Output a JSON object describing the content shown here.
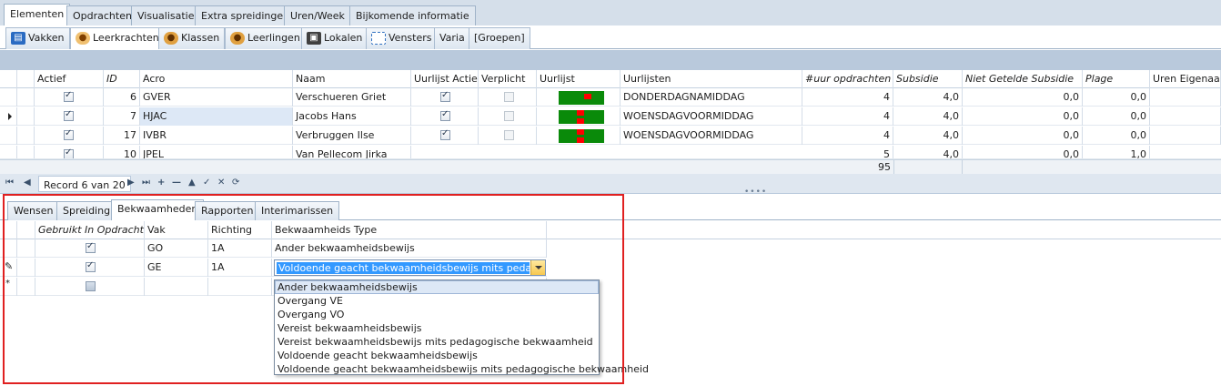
{
  "tabs_level1": [
    "Elementen",
    "Opdrachten",
    "Visualisatie",
    "Extra spreidingen",
    "Uren/Week",
    "Bijkomende informatie"
  ],
  "tabs_level2": [
    {
      "label": "Vakken",
      "icon": "book-icon"
    },
    {
      "label": "Leerkrachten",
      "icon": "person-icon"
    },
    {
      "label": "Klassen",
      "icon": "group-icon"
    },
    {
      "label": "Leerlingen",
      "icon": "students-icon"
    },
    {
      "label": "Lokalen",
      "icon": "room-icon"
    },
    {
      "label": "Vensters",
      "icon": "window-icon"
    },
    {
      "label": "Varia",
      "icon": ""
    },
    {
      "label": "[Groepen]",
      "icon": ""
    }
  ],
  "main_grid": {
    "columns": [
      "Actief",
      "ID",
      "Acro",
      "Naam",
      "Uurlijst Actief",
      "Verplicht",
      "Uurlijst",
      "Uurlijsten",
      "#uur opdrachten",
      "Subsidie",
      "Niet Getelde Subsidie",
      "Plage",
      "Uren Eigenaar"
    ],
    "rows": [
      {
        "id": "6",
        "acro": "GVER",
        "naam": "Verschueren Griet",
        "uurlijsten": "DONDERDAGNAMIDDAG",
        "uur": "4",
        "subsidie": "4,0",
        "niet": "0,0",
        "plage": "0,0"
      },
      {
        "id": "7",
        "acro": "HJAC",
        "naam": "Jacobs Hans",
        "uurlijsten": "WOENSDAGVOORMIDDAG",
        "uur": "4",
        "subsidie": "4,0",
        "niet": "0,0",
        "plage": "0,0"
      },
      {
        "id": "17",
        "acro": "IVBR",
        "naam": "Verbruggen Ilse",
        "uurlijsten": "WOENSDAGVOORMIDDAG",
        "uur": "4",
        "subsidie": "4,0",
        "niet": "0,0",
        "plage": "0,0"
      },
      {
        "id": "10",
        "acro": "JPEL",
        "naam": "Van Pellecom Jirka",
        "uurlijsten": "",
        "uur": "5",
        "subsidie": "4,0",
        "niet": "0,0",
        "plage": "1,0"
      }
    ],
    "sum": "95"
  },
  "navigator": {
    "record_text": "Record 6 van 20"
  },
  "tabs_level3": [
    "Wensen",
    "Spreiding",
    "Bekwaamheden",
    "Rapporten",
    "Interimarissen"
  ],
  "sub_grid": {
    "columns": [
      "Gebruikt In Opdracht",
      "Vak",
      "Richting",
      "Bekwaamheids Type"
    ],
    "rows": [
      {
        "vak": "GO",
        "richting": "1A",
        "type": "Ander bekwaamheidsbewijs"
      },
      {
        "vak": "GE",
        "richting": "1A",
        "type": "Voldoende geacht bekwaamheidsbewijs mits pedagogisch"
      }
    ]
  },
  "dropdown_options": [
    "Ander bekwaamheidsbewijs",
    "Overgang VE",
    "Overgang VO",
    "Vereist bekwaamheidsbewijs",
    "Vereist bekwaamheidsbewijs mits pedagogische bekwaamheid",
    "Voldoende geacht bekwaamheidsbewijs",
    "Voldoende geacht bekwaamheidsbewijs mits pedagogische bekwaamheid"
  ],
  "colors": {
    "accent": "#3399ff",
    "highlight": "#e02020",
    "uurlijst_green": "#0a8a0a",
    "uurlijst_red": "#ff0000"
  }
}
